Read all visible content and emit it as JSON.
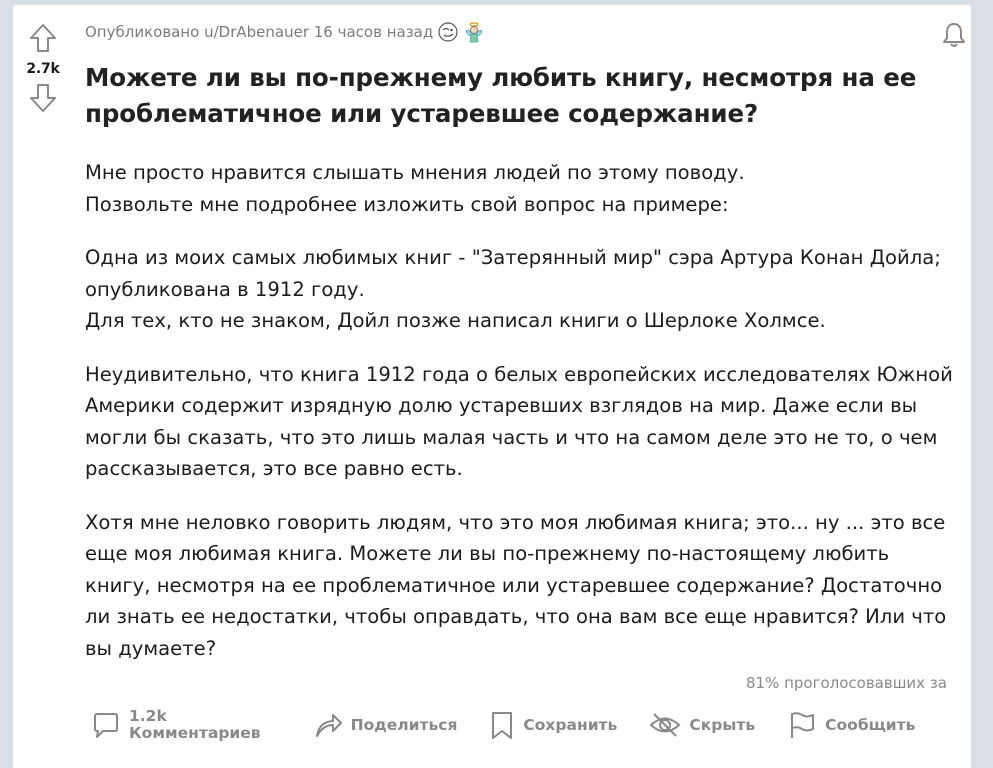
{
  "post": {
    "score": "2.7k",
    "meta": "Опубликовано u/DrAbenauer 16 часов назад",
    "title_lines": [
      "Можете ли вы по-прежнему любить книгу, несмотря на ее",
      "проблематичное или устаревшее содержание?"
    ],
    "paragraphs": [
      [
        "Мне просто нравится слышать мнения людей по этому поводу.",
        "Позвольте мне подробнее изложить свой вопрос на примере:"
      ],
      [
        "Одна из моих самых любимых книг - \"Затерянный мир\" сэра Артура Конан Дойла;",
        "опубликована в 1912 году.",
        "Для тех, кто не знаком, Дойл позже написал книги о Шерлоке Холмсе."
      ],
      [
        "Неудивительно, что книга 1912 года о белых европейских исследователях Южной",
        "Америки содержит изрядную долю устаревших взглядов на мир. Даже если вы",
        "могли бы сказать, что это лишь малая часть и что на самом деле это не то, о чем",
        "рассказывается, это все равно есть."
      ],
      [
        "Хотя мне неловко говорить людям, что это моя любимая книга; это... ну ... это все",
        "еще моя любимая книга. Можете ли вы по-прежнему по-настоящему любить",
        "книгу, несмотря на ее проблематичное или устаревшее содержание? Достаточно",
        "ли знать ее недостатки, чтобы оправдать, что она вам все еще нравится? Или что",
        "вы думаете?"
      ]
    ],
    "upvote_ratio": "81% проголосовавших за"
  },
  "actions": {
    "comments_count": "1.2k",
    "comments_label": "Комментариев",
    "share": "Поделиться",
    "save": "Сохранить",
    "hide": "Скрыть",
    "report": "Сообщить"
  },
  "icons": {
    "upvote": "upvote-arrow-icon",
    "downvote": "downvote-arrow-icon",
    "bell": "bell-icon",
    "award1": "award-icon",
    "award2": "angel-award-icon",
    "comment": "comment-icon",
    "share": "share-arrow-icon",
    "save": "bookmark-icon",
    "hide": "eye-slash-icon",
    "report": "flag-icon"
  },
  "colors": {
    "page_bg": "#dae0e6",
    "card_bg": "#ffffff",
    "meta_text": "#787c7e",
    "action_text": "#878a8c",
    "title_text": "#222222"
  }
}
